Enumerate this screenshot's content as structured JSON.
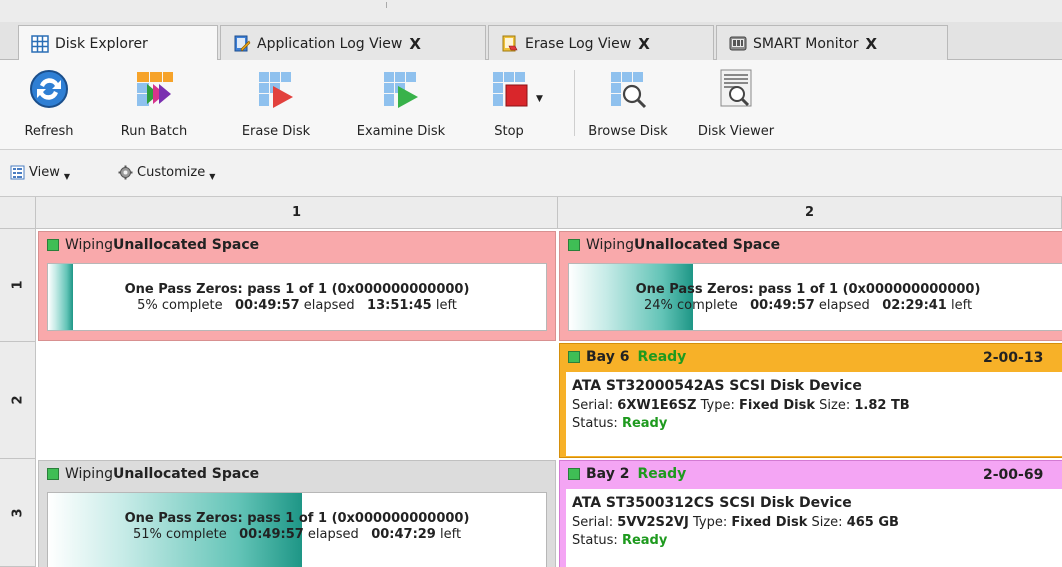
{
  "tabs": [
    {
      "label": "Disk Explorer",
      "icon": "grid-icon",
      "active": true
    },
    {
      "label": "Application Log View",
      "icon": "log-icon",
      "close": "X"
    },
    {
      "label": "Erase Log View",
      "icon": "erase-log-icon",
      "close": "X"
    },
    {
      "label": "SMART Monitor",
      "icon": "monitor-icon",
      "close": "X"
    }
  ],
  "ribbon": {
    "refresh": "Refresh",
    "run_batch": "Run Batch",
    "erase_disk": "Erase Disk",
    "examine_disk": "Examine Disk",
    "stop": "Stop",
    "browse_disk": "Browse Disk",
    "disk_viewer": "Disk Viewer"
  },
  "viewbar": {
    "view": "View",
    "customize": "Customize"
  },
  "grid": {
    "columns": [
      "1",
      "2"
    ],
    "rows": [
      "1",
      "2",
      "3"
    ]
  },
  "cells": {
    "r1c1": {
      "prefix": "Wiping ",
      "title": "Unallocated Space",
      "line1": "One Pass Zeros: pass 1 of 1 (0x000000000000)",
      "pct": "5%",
      "pct_suffix": " complete",
      "elapsed": "00:49:57",
      "elapsed_label": " elapsed",
      "left": "13:51:45",
      "left_label": " left",
      "progress": 0.05
    },
    "r1c2": {
      "prefix": "Wiping ",
      "title": "Unallocated Space",
      "line1": "One Pass Zeros: pass 1 of 1 (0x000000000000)",
      "pct": "24%",
      "pct_suffix": " complete",
      "elapsed": "00:49:57",
      "elapsed_label": " elapsed",
      "left": "02:29:41",
      "left_label": " left",
      "progress": 0.24
    },
    "r2c2": {
      "bay": "Bay 6",
      "status": "Ready",
      "code": "2-00-13",
      "device": "ATA ST32000542AS SCSI Disk Device",
      "serial_label": "Serial: ",
      "serial": "6XW1E6SZ",
      "type_label": " Type: ",
      "type": "Fixed Disk",
      "size_label": "  Size: ",
      "size": "1.82 TB",
      "status_label": "Status: ",
      "status_value": "Ready"
    },
    "r3c1": {
      "prefix": "Wiping ",
      "title": "Unallocated Space",
      "line1": "One Pass Zeros: pass 1 of 1 (0x000000000000)",
      "pct": "51%",
      "pct_suffix": " complete",
      "elapsed": "00:49:57",
      "elapsed_label": " elapsed",
      "left": "00:47:29",
      "left_label": " left",
      "progress": 0.51
    },
    "r3c2": {
      "bay": "Bay 2",
      "status": "Ready",
      "code": "2-00-69",
      "device": "ATA ST3500312CS SCSI Disk Device",
      "serial_label": "Serial: ",
      "serial": "5VV2S2VJ",
      "type_label": " Type: ",
      "type": "Fixed Disk",
      "size_label": "  Size: ",
      "size": "465 GB",
      "status_label": "Status: ",
      "status_value": "Ready"
    }
  },
  "colors": {
    "wipe_bg": "#f9a9ab",
    "bay6_bg": "#f7b128",
    "bay2_bg": "#f4a5f4",
    "ready_text": "#1e9a1e",
    "progress_fill": "#1e9686"
  }
}
